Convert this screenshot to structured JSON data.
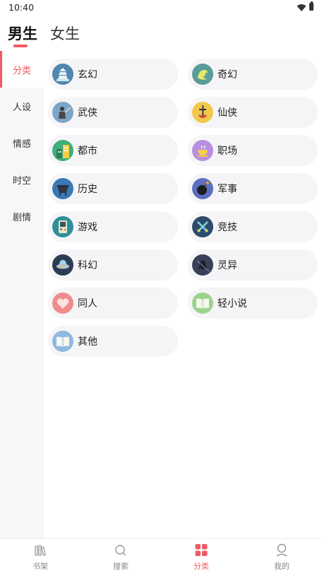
{
  "status_bar": {
    "time": "10:40"
  },
  "gender_tabs": {
    "male": "男生",
    "female": "女生"
  },
  "sidebar": {
    "items": [
      {
        "label": "分类",
        "active": true
      },
      {
        "label": "人设",
        "active": false
      },
      {
        "label": "情感",
        "active": false
      },
      {
        "label": "时空",
        "active": false
      },
      {
        "label": "剧情",
        "active": false
      }
    ]
  },
  "categories": [
    {
      "label": "玄幻",
      "icon": "pagoda-icon",
      "color": "#4f87b0"
    },
    {
      "label": "奇幻",
      "icon": "dragon-icon",
      "color": "#5a9c9a"
    },
    {
      "label": "武侠",
      "icon": "swordsman-icon",
      "color": "#7da6c6"
    },
    {
      "label": "仙侠",
      "icon": "sword-icon",
      "color": "#f2c84b"
    },
    {
      "label": "都市",
      "icon": "buildings-icon",
      "color": "#3fae7a"
    },
    {
      "label": "职场",
      "icon": "coffee-cup-icon",
      "color": "#b98de0"
    },
    {
      "label": "历史",
      "icon": "cauldron-icon",
      "color": "#3a77b5"
    },
    {
      "label": "军事",
      "icon": "bomb-icon",
      "color": "#5d6fc0"
    },
    {
      "label": "游戏",
      "icon": "gameboy-icon",
      "color": "#2f8f9c"
    },
    {
      "label": "竞技",
      "icon": "crossed-swords-icon",
      "color": "#2e4a6b"
    },
    {
      "label": "科幻",
      "icon": "ufo-icon",
      "color": "#2d3c55"
    },
    {
      "label": "灵异",
      "icon": "ghost-icon",
      "color": "#3a3f5a"
    },
    {
      "label": "同人",
      "icon": "heart-icon",
      "color": "#f08c8c"
    },
    {
      "label": "轻小说",
      "icon": "book-icon",
      "color": "#9bd38c"
    },
    {
      "label": "其他",
      "icon": "book-icon",
      "color": "#8fb9e0"
    }
  ],
  "bottom_nav": {
    "items": [
      {
        "label": "书架",
        "icon": "bookshelf-icon",
        "active": false
      },
      {
        "label": "搜索",
        "icon": "search-icon",
        "active": false
      },
      {
        "label": "分类",
        "icon": "category-grid-icon",
        "active": true
      },
      {
        "label": "我的",
        "icon": "user-icon",
        "active": false
      }
    ]
  },
  "colors": {
    "accent": "#f05a62",
    "pill_bg": "#f5f5f7",
    "sidebar_bg": "#f7f7f7"
  }
}
